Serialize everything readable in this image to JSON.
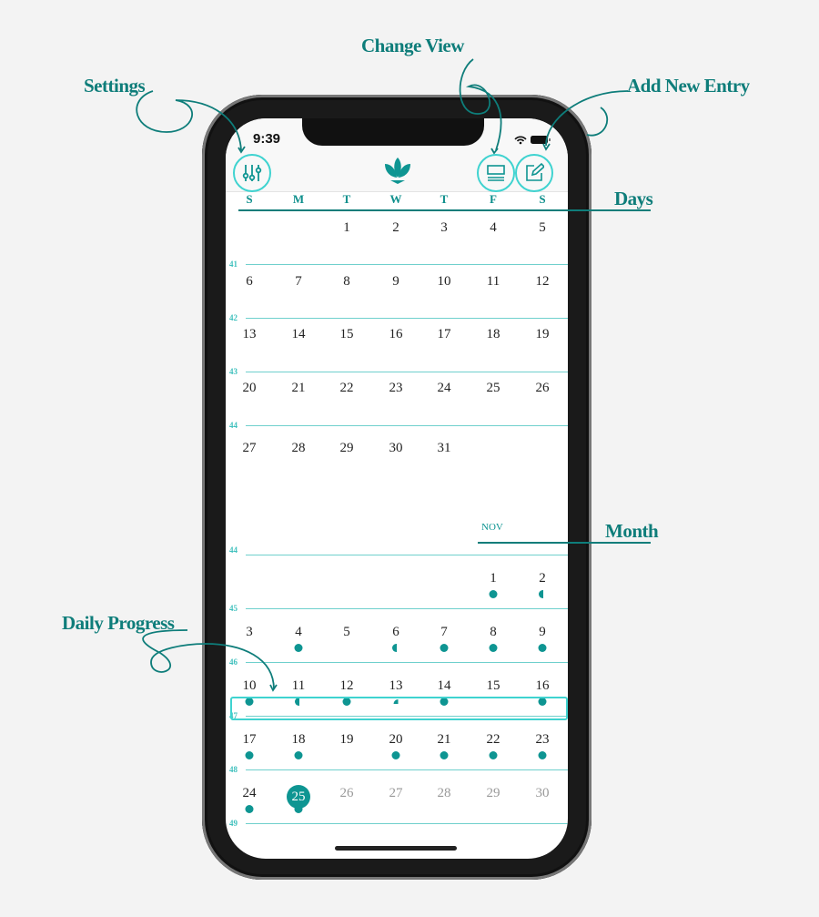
{
  "status_bar": {
    "time": "9:39"
  },
  "header": {
    "settings_icon": "sliders-icon",
    "logo_icon": "lotus-icon",
    "change_view_icon": "layout-icon",
    "add_entry_icon": "edit-icon"
  },
  "days_of_week": [
    "S",
    "M",
    "T",
    "W",
    "T",
    "F",
    "S"
  ],
  "october": {
    "weeks": [
      {
        "week": "41",
        "days": [
          "",
          "",
          "1",
          "2",
          "3",
          "4",
          "5"
        ]
      },
      {
        "week": "42",
        "days": [
          "6",
          "7",
          "8",
          "9",
          "10",
          "11",
          "12"
        ]
      },
      {
        "week": "43",
        "days": [
          "13",
          "14",
          "15",
          "16",
          "17",
          "18",
          "19"
        ]
      },
      {
        "week": "44",
        "days": [
          "20",
          "21",
          "22",
          "23",
          "24",
          "25",
          "26"
        ]
      },
      {
        "week": "",
        "days": [
          "27",
          "28",
          "29",
          "30",
          "31",
          "",
          ""
        ]
      }
    ]
  },
  "november": {
    "label": "NOV",
    "today": "25",
    "weeks": [
      {
        "week": "44",
        "days": [
          "",
          "",
          "",
          "",
          "",
          "1",
          "2"
        ],
        "progress": [
          null,
          null,
          null,
          null,
          null,
          1,
          0.5
        ]
      },
      {
        "week": "45",
        "days": [
          "3",
          "4",
          "5",
          "6",
          "7",
          "8",
          "9"
        ],
        "progress": [
          null,
          1,
          null,
          0.5,
          1,
          1,
          1
        ]
      },
      {
        "week": "46",
        "days": [
          "10",
          "11",
          "12",
          "13",
          "14",
          "15",
          "16"
        ],
        "progress": [
          1,
          0.5,
          1,
          0.25,
          1,
          null,
          1
        ]
      },
      {
        "week": "47",
        "days": [
          "17",
          "18",
          "19",
          "20",
          "21",
          "22",
          "23"
        ],
        "progress": [
          1,
          1,
          null,
          1,
          1,
          1,
          1
        ]
      },
      {
        "week": "48",
        "days": [
          "24",
          "25",
          "26",
          "27",
          "28",
          "29",
          "30"
        ],
        "progress": [
          1,
          1,
          null,
          null,
          null,
          null,
          null
        ]
      },
      {
        "week": "49",
        "days": [],
        "progress": []
      }
    ]
  },
  "annotations": {
    "settings": "Settings",
    "change_view": "Change View",
    "add_new_entry": "Add New Entry",
    "days": "Days",
    "month": "Month",
    "daily_progress": "Daily Progress"
  },
  "colors": {
    "accent": "#0e9592",
    "annotation": "#0e7d7a",
    "highlight": "#3fd3d0"
  }
}
